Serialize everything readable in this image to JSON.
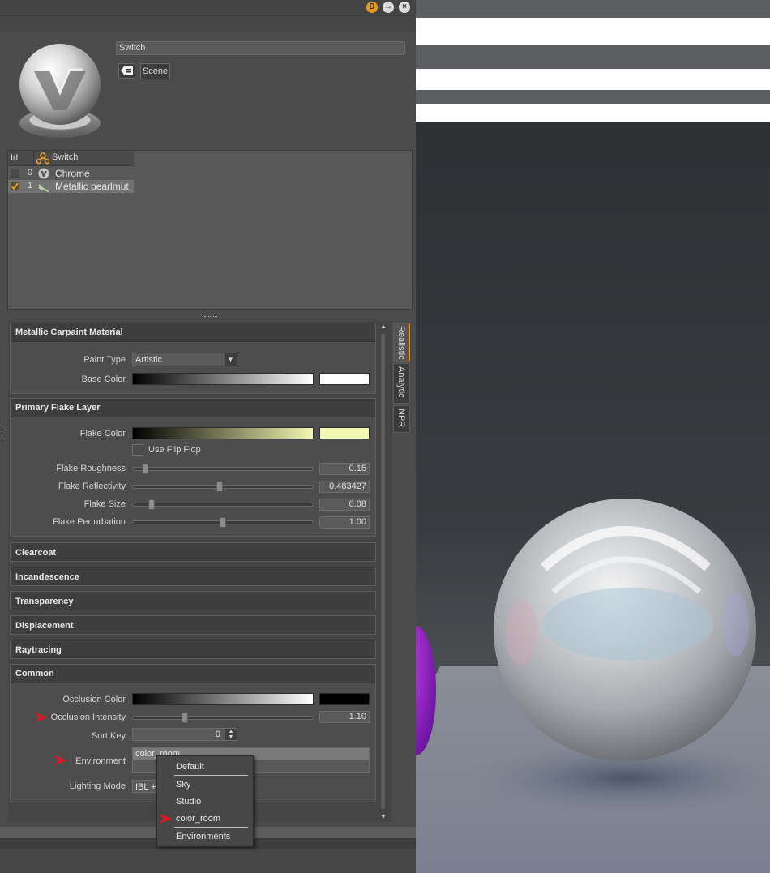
{
  "window": {
    "title_buttons": [
      "D",
      "→",
      "×"
    ]
  },
  "material": {
    "name": "Switch",
    "scene_button": "Scene"
  },
  "list": {
    "headers": {
      "id": "Id",
      "switch": "Switch"
    },
    "rows": [
      {
        "id": "0",
        "label": "Chrome",
        "checked": false,
        "selected": false
      },
      {
        "id": "1",
        "label": "Metallic pearlmut",
        "checked": true,
        "selected": true
      }
    ]
  },
  "groups": {
    "carpaint": {
      "title": "Metallic Carpaint Material",
      "paint_type_label": "Paint Type",
      "paint_type_value": "Artistic",
      "base_color_label": "Base Color",
      "base_color": "#ffffff"
    },
    "flake": {
      "title": "Primary Flake Layer",
      "flake_color_label": "Flake Color",
      "flake_color": "#f2f8b2",
      "flip_flop_label": "Use Flip Flop",
      "sliders": [
        {
          "label": "Flake Roughness",
          "value": "0.15",
          "level": 0.05
        },
        {
          "label": "Flake Reflectivity",
          "value": "0.483427",
          "level": 0.48
        },
        {
          "label": "Flake Size",
          "value": "0.08",
          "level": 0.09
        },
        {
          "label": "Flake Perturbation",
          "value": "1.00",
          "level": 0.5
        }
      ]
    },
    "collapsed": [
      "Clearcoat",
      "Incandescence",
      "Transparency",
      "Displacement",
      "Raytracing"
    ],
    "common": {
      "title": "Common",
      "occlusion_color_label": "Occlusion Color",
      "occlusion_color": "#000000",
      "occlusion_intensity_label": "Occlusion Intensity",
      "occlusion_intensity_value": "1.10",
      "occlusion_intensity_level": 0.28,
      "sort_key_label": "Sort Key",
      "sort_key_value": "0",
      "environment_label": "Environment",
      "environment_value": "color_room",
      "lighting_mode_label": "Lighting Mode",
      "lighting_mode_value": "IBL +"
    }
  },
  "tabs": [
    "Realistic",
    "Analytic",
    "NPR"
  ],
  "environment_menu": [
    "Default",
    "Sky",
    "Studio",
    "color_room",
    "Environments"
  ],
  "colors": {
    "accent": "#e88f1a",
    "marker": "#e8141c",
    "panel": "#4b4b4b"
  }
}
